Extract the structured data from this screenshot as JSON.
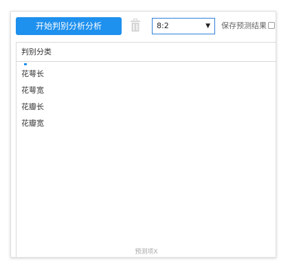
{
  "toolbar": {
    "run_button_label": "开始判别分析分析",
    "split_select_value": "8:2",
    "save_prediction_label": "保存预测结果"
  },
  "field_box": {
    "label": "判别分类"
  },
  "list": {
    "items": [
      "花萼长",
      "花萼宽",
      "花瓣长",
      "花瓣宽"
    ],
    "footer_label": "预测项X"
  },
  "colors": {
    "primary": "#1e90ee",
    "select_border": "#2b7fd9"
  },
  "icons": {
    "trash": "trash-icon",
    "dropdown": "caret-down-icon",
    "checkbox": "checkbox-unchecked"
  }
}
